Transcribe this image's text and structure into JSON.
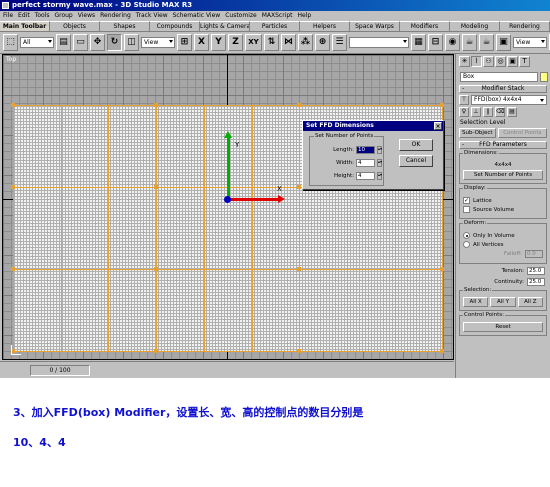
{
  "window": {
    "title": "perfect stormy wave.max - 3D Studio MAX R3"
  },
  "menu": [
    "File",
    "Edit",
    "Tools",
    "Group",
    "Views",
    "Rendering",
    "Track View",
    "Schematic View",
    "Customize",
    "MAXScript",
    "Help"
  ],
  "tabs": [
    "Main Toolbar",
    "Objects",
    "Shapes",
    "Compounds",
    "Lights & Cameras",
    "Particles",
    "Helpers",
    "Space Warps",
    "Modifiers",
    "Modeling",
    "Rendering"
  ],
  "toolbar": {
    "selection_filter": "All",
    "ref_coord": "View",
    "transform_x": "X",
    "transform_y": "Y",
    "transform_z": "Z",
    "transform_xy": "XY",
    "ref_coord_right": "View"
  },
  "viewport": {
    "label": "Top",
    "gizmo_y": "Y",
    "gizmo_x": "X"
  },
  "dialog": {
    "title": "Set FFD Dimensions",
    "group_label": "Set Number of Points",
    "length_label": "Length:",
    "length_value": "10",
    "width_label": "Width:",
    "width_value": "4",
    "height_label": "Height:",
    "height_value": "4",
    "ok": "OK",
    "cancel": "Cancel"
  },
  "status": {
    "frame": "0 / 100"
  },
  "panel": {
    "object_name": "Box",
    "stack_header": "Modifier Stack",
    "stack_value": "FFD(box) 4x4x4",
    "selection_level": "Selection Level",
    "sub_object": "Sub-Object",
    "control_points": "Control Points",
    "ffd_params": "FFD Parameters",
    "dimensions_label": "Dimensions:",
    "dimensions_value": "4x4x4",
    "set_points_btn": "Set Number of Points",
    "display_label": "Display:",
    "lattice": "Lattice",
    "source_volume": "Source Volume",
    "deform_label": "Deform:",
    "only_in_volume": "Only In Volume",
    "all_vertices": "All Vertices",
    "falloff_label": "Falloff:",
    "falloff_value": "0.0",
    "tension_label": "Tension:",
    "tension_value": "25.0",
    "continuity_label": "Continuity:",
    "continuity_value": "25.0",
    "selection_label": "Selection:",
    "all_x": "All X",
    "all_y": "All Y",
    "all_z": "All Z",
    "control_points_label": "Control Points:",
    "reset": "Reset"
  },
  "caption": {
    "line1": "3、加入FFD(box) Modifier，设置长、宽、高的控制点的数目分别是",
    "line2": "10、4、4"
  },
  "colors": {
    "title_bar": "#000080",
    "lattice": "#e8a030",
    "caption": "#1010d0",
    "gizmo_x": "#e00000",
    "gizmo_y": "#00b000"
  }
}
